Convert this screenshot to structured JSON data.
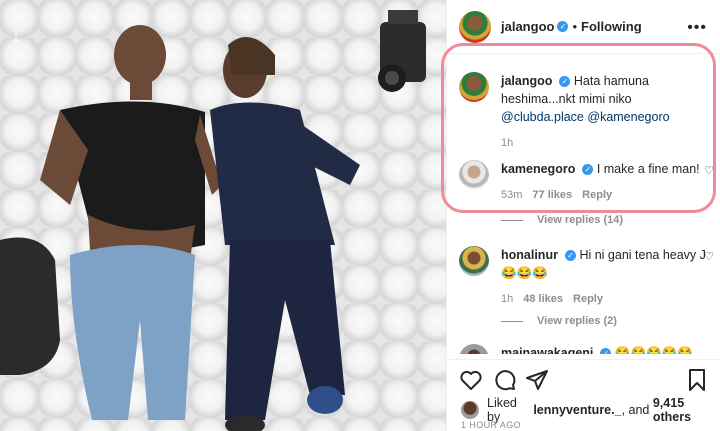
{
  "post": {
    "username": "jalangoo",
    "following_label": "Following",
    "more_label": "•••"
  },
  "comments": [
    {
      "username": "jalangoo",
      "text": "Hata hamuna heshima...nkt mimi niko",
      "mention1": "@clubda.place",
      "mention2": "@kamenegoro",
      "time": "1h"
    },
    {
      "username": "kamenegoro",
      "text": "I make a fine man!",
      "time": "53m",
      "likes": "77 likes",
      "reply": "Reply",
      "view_replies": "View replies (14)"
    },
    {
      "username": "honalinur",
      "text": "Hi ni gani tena heavy",
      "emojis": "J😂😂😂",
      "time": "1h",
      "likes": "48 likes",
      "reply": "Reply",
      "view_replies": "View replies (2)"
    },
    {
      "username": "mainawakageni",
      "emojis": "😂😂😂😂😂"
    }
  ],
  "likes_line": {
    "prefix": "Liked by",
    "user": "lennyventure._",
    "middle": "and",
    "count": "9,415 others"
  },
  "timestamp": "1 HOUR AGO",
  "icons": [
    "heart-icon",
    "comment-icon",
    "share-icon",
    "bookmark-icon",
    "verified-icon",
    "photo-nav-arrow-icon"
  ],
  "colors": {
    "highlight": "#ee8a9a",
    "verified": "#3897f0",
    "link": "#00376b"
  }
}
